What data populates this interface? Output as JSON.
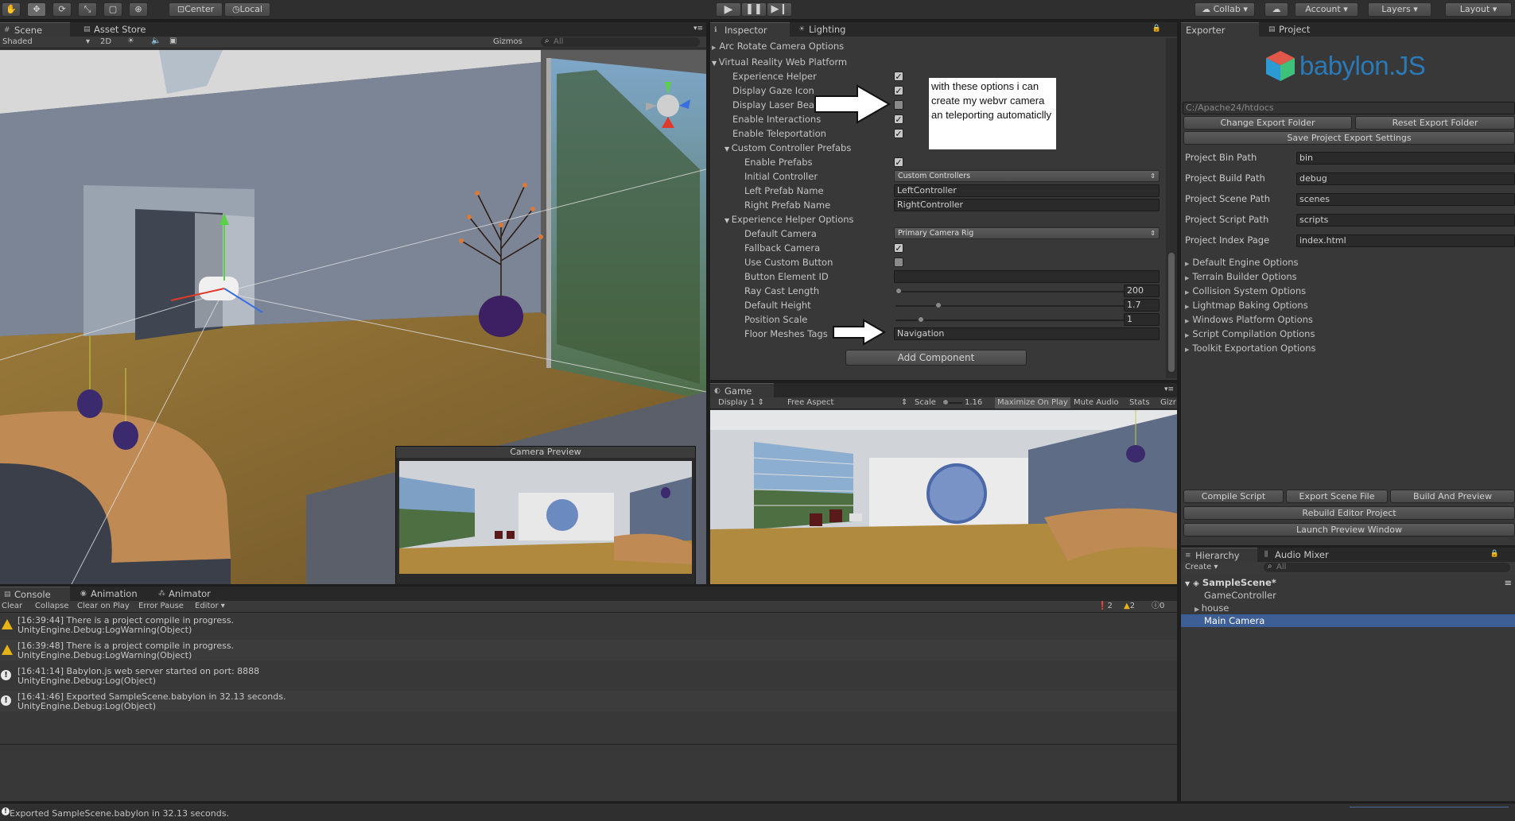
{
  "toolbar": {
    "center": "Center",
    "local": "Local",
    "collab": "Collab",
    "account": "Account",
    "layers": "Layers",
    "layout": "Layout"
  },
  "scene": {
    "tab_scene": "Scene",
    "tab_asset_store": "Asset Store",
    "shading": "Shaded",
    "mode_2d": "2D",
    "gizmos": "Gizmos",
    "search_placeholder": "All",
    "camera_preview_title": "Camera Preview"
  },
  "inspector": {
    "tab_inspector": "Inspector",
    "tab_lighting": "Lighting",
    "rows": {
      "arc_rotate": "Arc Rotate Camera Options",
      "vr_web_platform": "Virtual Reality Web Platform",
      "experience_helper": "Experience Helper",
      "display_gaze_icon": "Display Gaze Icon",
      "display_laser_beam": "Display Laser Beam",
      "enable_interactions": "Enable Interactions",
      "enable_teleportation": "Enable Teleportation",
      "custom_controller_prefabs": "Custom Controller Prefabs",
      "enable_prefabs": "Enable Prefabs",
      "initial_controller": "Initial Controller",
      "left_prefab_name": "Left Prefab Name",
      "right_prefab_name": "Right Prefab Name",
      "experience_helper_options": "Experience Helper Options",
      "default_camera": "Default Camera",
      "fallback_camera": "Fallback Camera",
      "use_custom_button": "Use Custom Button",
      "button_element_id": "Button Element ID",
      "ray_cast_length": "Ray Cast Length",
      "default_height": "Default Height",
      "position_scale": "Position Scale",
      "floor_meshes_tags": "Floor Meshes Tags"
    },
    "values": {
      "initial_controller": "Custom Controllers",
      "left_prefab_name": "LeftController",
      "right_prefab_name": "RightController",
      "default_camera": "Primary Camera Rig",
      "ray_cast_length": "200",
      "default_height": "1.7",
      "position_scale": "1",
      "floor_meshes_tags": "Navigation"
    },
    "sliders": {
      "ray_cast_length": 0.0,
      "default_height": 0.18,
      "position_scale": 0.1
    },
    "add_component": "Add Component",
    "annotation": "with these options i can create my webvr camera an teleporting automaticlly"
  },
  "game": {
    "tab_game": "Game",
    "display": "Display 1",
    "aspect": "Free Aspect",
    "scale_label": "Scale",
    "scale_value": "1.16",
    "maximize_on_play": "Maximize On Play",
    "mute_audio": "Mute Audio",
    "stats": "Stats",
    "gizmos": "Gizr"
  },
  "exporter": {
    "tab_exporter": "Exporter",
    "tab_project": "Project",
    "logo_text": "babylon.JS",
    "export_path": "C:/Apache24/htdocs",
    "change_export_folder": "Change Export Folder",
    "reset_export_folder": "Reset Export Folder",
    "save_project_settings": "Save Project Export Settings",
    "fields": [
      {
        "label": "Project Bin Path",
        "value": "bin"
      },
      {
        "label": "Project Build Path",
        "value": "debug"
      },
      {
        "label": "Project Scene Path",
        "value": "scenes"
      },
      {
        "label": "Project Script Path",
        "value": "scripts"
      },
      {
        "label": "Project Index Page",
        "value": "index.html"
      }
    ],
    "foldouts": [
      "Default Engine Options",
      "Terrain Builder Options",
      "Collision System Options",
      "Lightmap Baking Options",
      "Windows Platform Options",
      "Script Compilation Options",
      "Toolkit Exportation Options"
    ],
    "compile_script": "Compile Script",
    "export_scene_file": "Export Scene File",
    "build_and_preview": "Build And Preview",
    "rebuild_editor_project": "Rebuild Editor Project",
    "launch_preview_window": "Launch Preview Window"
  },
  "hierarchy": {
    "tab_hierarchy": "Hierarchy",
    "tab_audio_mixer": "Audio Mixer",
    "create": "Create",
    "search_placeholder": "All",
    "scene_name": "SampleScene*",
    "items": [
      "GameController",
      "house",
      "Main Camera"
    ]
  },
  "console": {
    "tab_console": "Console",
    "tab_animation": "Animation",
    "tab_animator": "Animator",
    "clear": "Clear",
    "collapse": "Collapse",
    "clear_on_play": "Clear on Play",
    "error_pause": "Error Pause",
    "editor": "Editor",
    "count_info": "2",
    "count_warn": "2",
    "count_error": "0",
    "entries": [
      {
        "line1": "[16:39:44] There is a project compile in progress.",
        "line2": "UnityEngine.Debug:LogWarning(Object)"
      },
      {
        "line1": "[16:39:48] There is a project compile in progress.",
        "line2": "UnityEngine.Debug:LogWarning(Object)"
      },
      {
        "line1": "[16:41:14] Babylon.js web server started on port: 8888",
        "line2": "UnityEngine.Debug:Log(Object)"
      },
      {
        "line1": "[16:41:46] Exported SampleScene.babylon in 32.13 seconds.",
        "line2": "UnityEngine.Debug:Log(Object)"
      }
    ]
  },
  "status_bar": "Exported SampleScene.babylon in 32.13 seconds."
}
